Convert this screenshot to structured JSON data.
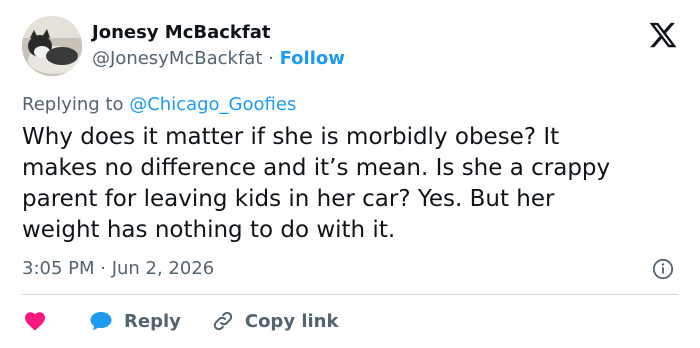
{
  "author": {
    "name": "Jonesy McBackfat",
    "handle": "@JonesyMcBackfat",
    "separator": "·",
    "follow_label": "Follow"
  },
  "replying": {
    "prefix": "Replying to",
    "mention": "@Chicago_Goofies"
  },
  "tweet": {
    "text": "Why does it matter if she is morbidly obese?  It\nmakes no difference and it’s mean. Is she a crappy\nparent for leaving kids in her car? Yes. But her\nweight has nothing to do with it.",
    "timestamp": "3:05 PM · Jun 2, 2026"
  },
  "actions": {
    "reply_label": "Reply",
    "copy_link_label": "Copy link"
  },
  "icons": {
    "brand": "x-logo-icon",
    "info": "info-icon",
    "like": "heart-icon",
    "reply": "speech-bubble-icon",
    "copy": "link-icon"
  },
  "colors": {
    "accent": "#1d9bf0",
    "heart": "#f91880",
    "text": "#0f1419",
    "muted": "#536471",
    "divider": "#cfd9de"
  }
}
